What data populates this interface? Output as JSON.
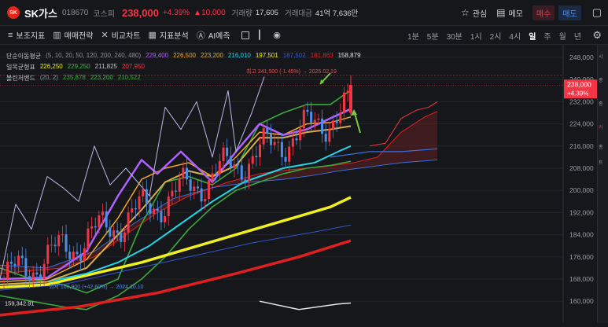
{
  "header": {
    "name": "SK가스",
    "code": "018670",
    "market": "코스피",
    "price": "238,000",
    "pct": "+4.39%",
    "change": "▲10,000",
    "volume_label": "거래량",
    "volume": "17,605",
    "amount_label": "거래대금",
    "amount": "41억 7,636만",
    "fav_label": "관심",
    "memo_label": "메모",
    "buy_label": "매수",
    "sell_label": "매도"
  },
  "toolbar": {
    "items": [
      "보조지표",
      "매매전략",
      "비교차트",
      "지표분석",
      "AI예측"
    ],
    "periods": [
      "1분",
      "5분",
      "30분",
      "1시",
      "2시",
      "4시",
      "일",
      "주",
      "월",
      "년"
    ],
    "active_period": "일"
  },
  "legend": {
    "ma": {
      "label": "단순이동평균",
      "params": "(5, 10, 20, 50, 120, 200, 240, 480)",
      "values": [
        "229,400",
        "226,500",
        "223,200",
        "216,010",
        "197,501",
        "187,502",
        "181,863",
        "158,879"
      ],
      "colors": [
        "#b061ff",
        "#f5a623",
        "#d8b04a",
        "#20d6e6",
        "#f0f020",
        "#3355cc",
        "#e02020",
        "#e6e6e6"
      ]
    },
    "ichimoku": {
      "label": "일목균형표",
      "values": [
        "226,250",
        "229,250",
        "211,825",
        "207,950"
      ],
      "colors": [
        "#f0f020",
        "#4caf50",
        "#c0c3ca",
        "#f23645"
      ]
    },
    "bollinger": {
      "label": "볼린저밴드",
      "params": "(20, 2)",
      "values": [
        "235,878",
        "223,200",
        "210,522"
      ],
      "colors": [
        "#3aa83a",
        "#4caf50",
        "#3aa83a"
      ]
    }
  },
  "annotations": {
    "high": "최고 241,500 (-1.45%) → 2025.02.19",
    "low": "최저 166,900 (+42.60%) → 2024.10.10",
    "bottom_value": "159,342.91"
  },
  "price_axis": {
    "ticks": [
      "248,000",
      "240,000",
      "232,000",
      "224,000",
      "216,000",
      "208,000",
      "200,000",
      "192,000",
      "184,000",
      "176,000",
      "168,000",
      "160,000"
    ],
    "current": "238,000",
    "current_pct": "+4.39%"
  },
  "right_strip": [
    "시",
    "종",
    "종",
    "커",
    "종",
    "트"
  ],
  "colors": {
    "up": "#f23645",
    "down": "#4d8fe8",
    "background": "#16171b"
  }
}
